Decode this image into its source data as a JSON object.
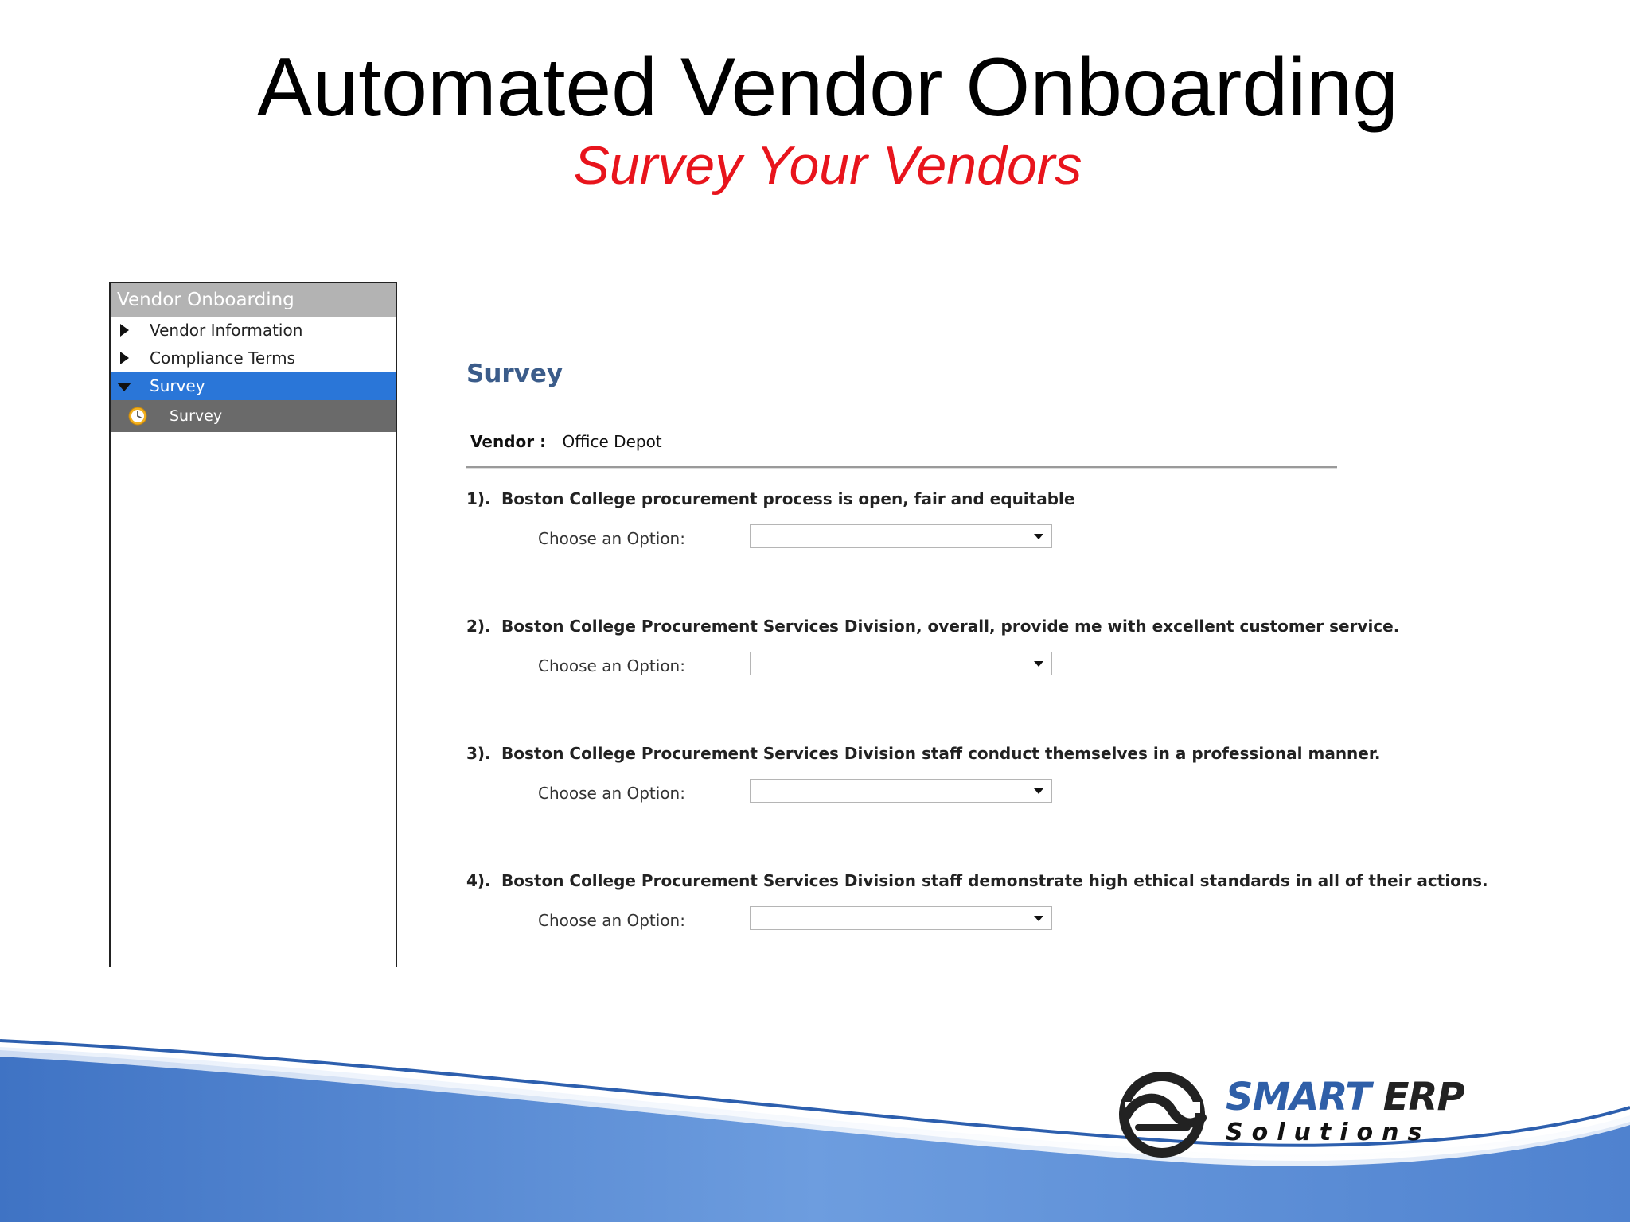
{
  "slide": {
    "title": "Automated Vendor Onboarding",
    "subtitle": "Survey Your Vendors"
  },
  "nav": {
    "header": "Vendor Onboarding",
    "items": [
      {
        "label": "Vendor Information"
      },
      {
        "label": "Compliance Terms"
      },
      {
        "label": "Survey"
      }
    ],
    "subitem": {
      "label": "Survey",
      "icon": "clock-icon"
    }
  },
  "survey": {
    "heading": "Survey",
    "vendor_label": "Vendor :",
    "vendor_value": "Office Depot",
    "questions": [
      {
        "num": "1).",
        "text": "Boston College procurement process is open, fair and equitable",
        "option_label": "Choose an Option:",
        "value": ""
      },
      {
        "num": "2).",
        "text": "Boston College Procurement Services Division, overall, provide me with excellent customer service.",
        "option_label": "Choose an Option:",
        "value": ""
      },
      {
        "num": "3).",
        "text": "Boston College Procurement Services Division staff conduct themselves in a professional manner.",
        "option_label": "Choose an Option:",
        "value": ""
      },
      {
        "num": "4).",
        "text": "Boston College Procurement Services Division staff demonstrate high ethical standards in all of their actions.",
        "option_label": "Choose an Option:",
        "value": ""
      }
    ]
  },
  "logo": {
    "smart": "SMART",
    "erp": "ERP",
    "sub": "Solutions"
  },
  "colors": {
    "accent_red": "#e8141c",
    "nav_active": "#2a76d8",
    "heading_blue": "#3b5c8a",
    "brand_blue": "#2f5fa8"
  }
}
